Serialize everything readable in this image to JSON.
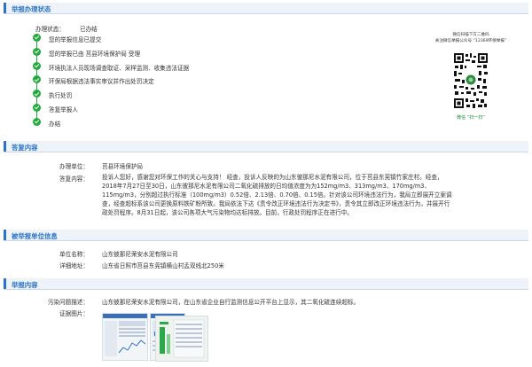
{
  "sections": {
    "status": "举报办理状态",
    "reply": "答复内容",
    "reported": "被举报单位信息",
    "report": "举报内容"
  },
  "status": {
    "key": "办理状态：",
    "value": "已办结",
    "steps": [
      "您的举报信息已提交",
      "您的举报已由 莒县环境保护局 受理",
      "环境执法人员现场调查取证、采样监测、收集违法证据",
      "环保局根据违法事实审议并作出处罚决定",
      "执行处罚",
      "答复举报人",
      "办结"
    ]
  },
  "qr": {
    "line1": "微信扫描下方二维码",
    "line2": "关注微信举报公众号 “12369环保举报”",
    "caption": "微信 “扫一扫”"
  },
  "reply": {
    "unit_key": "办理单位：",
    "unit_value": "莒县环境保护局",
    "content_key": "答复内容：",
    "content_lines": [
      "投诉人您好，感谢您对环保工作的关心与支持！ 经查，投诉人反映的为山东彼那尼水泥有限公司，位于莒县东莞镇竹家庄村。经查，",
      "2018年7月27日至30日，山东彼那尼水泥有限公司二氧化硫排放的日均值浓度为为152mg/m3、313mg/m3、170mg/m3、",
      "115mg/m3，分别超过执行标准（100mg/m3）0.52倍、2.13倍、0.70倍、0.15倍。针对该公司环境违法行为，我局立即展开立案调",
      "查，经查超标系该公司更换原料铁矿粉所致。我局依法下达《责令改正环境违法行为决定书》，责令其立即改正环境违法行为，并展开行",
      "政处罚程序。8月31日起，该公司各项大气污染物均达标排放。目前，行政处罚程序正在进行中。"
    ]
  },
  "reported": {
    "name_key": "单位名称：",
    "name_value": "山东彼那尼荣安水泥有限公司",
    "addr_key": "详细地址：",
    "addr_value": "山东省日照市莒县东莞镇横山村孟双线北250米"
  },
  "report": {
    "desc_key": "污染问题描述：",
    "desc_value": "山东彼那尼荣安水泥有限公司，在山东省企业自行监测信息公开平台上显示，其二氧化硫连续超标。",
    "photo_key": "证据图片："
  },
  "colors": {
    "accent": "#2b73c8",
    "ok": "#1faa39"
  }
}
